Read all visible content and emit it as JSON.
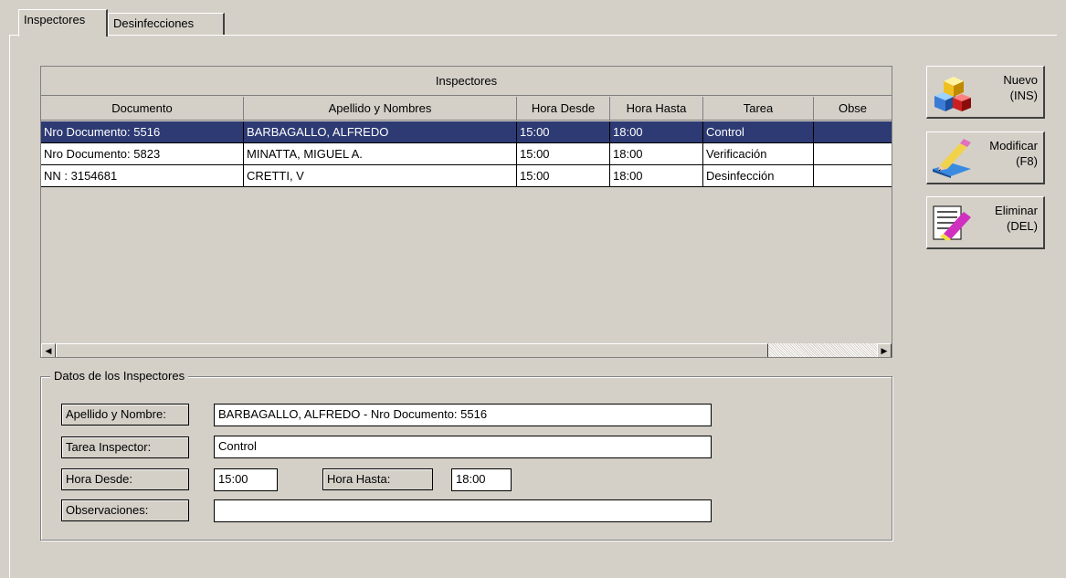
{
  "tabs": [
    {
      "label": "Inspectores",
      "active": true
    },
    {
      "label": "Desinfecciones",
      "active": false
    }
  ],
  "grid": {
    "title": "Inspectores",
    "columns": [
      "Documento",
      "Apellido y Nombres",
      "Hora Desde",
      "Hora Hasta",
      "Tarea",
      "Obse"
    ],
    "rows": [
      {
        "documento": "Nro Documento: 5516",
        "nombre": "BARBAGALLO, ALFREDO",
        "desde": "15:00",
        "hasta": "18:00",
        "tarea": "Control",
        "obs": "",
        "selected": true
      },
      {
        "documento": "Nro Documento: 5823",
        "nombre": "MINATTA, MIGUEL A.",
        "desde": "15:00",
        "hasta": "18:00",
        "tarea": "Verificación",
        "obs": "",
        "selected": false
      },
      {
        "documento": "NN : 3154681",
        "nombre": "CRETTI, V",
        "desde": "15:00",
        "hasta": "18:00",
        "tarea": "Desinfección",
        "obs": "",
        "selected": false
      }
    ]
  },
  "details": {
    "legend": "Datos de los Inspectores",
    "nombre_label": "Apellido y Nombre:",
    "nombre_value": "BARBAGALLO, ALFREDO - Nro Documento: 5516",
    "tarea_label": "Tarea Inspector:",
    "tarea_value": "Control",
    "desde_label": "Hora Desde:",
    "desde_value": "15:00",
    "hasta_label": "Hora Hasta:",
    "hasta_value": "18:00",
    "obs_label": "Observaciones:",
    "obs_value": ""
  },
  "actions": {
    "nuevo": {
      "line1": "Nuevo",
      "line2": "(INS)",
      "icon": "cubes-icon"
    },
    "modificar": {
      "line1": "Modificar",
      "line2": "(F8)",
      "icon": "pencil-edit-icon"
    },
    "eliminar": {
      "line1": "Eliminar",
      "line2": "(DEL)",
      "icon": "eraser-document-icon"
    }
  },
  "colors": {
    "window_bg": "#d4d0c8",
    "selection": "#2d3a73"
  }
}
